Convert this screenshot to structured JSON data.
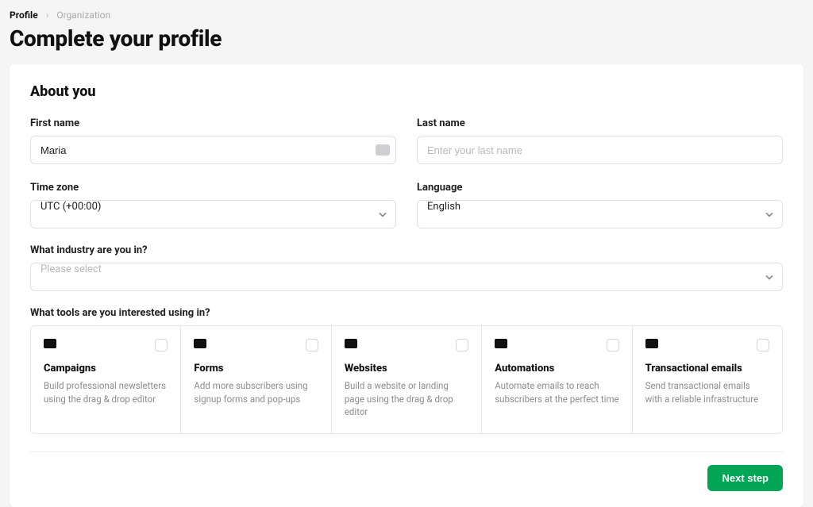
{
  "breadcrumb": {
    "active": "Profile",
    "next": "Organization"
  },
  "page_title": "Complete your profile",
  "section_title": "About you",
  "fields": {
    "first_name": {
      "label": "First name",
      "value": "Maria"
    },
    "last_name": {
      "label": "Last name",
      "value": "",
      "placeholder": "Enter your last name"
    },
    "timezone": {
      "label": "Time zone",
      "value": "UTC (+00:00)"
    },
    "language": {
      "label": "Language",
      "value": "English"
    },
    "industry": {
      "label": "What industry are you in?",
      "value": "",
      "placeholder": "Please select"
    }
  },
  "tools_label": "What tools are you interested using in?",
  "tools": [
    {
      "icon": "campaigns-icon",
      "title": "Campaigns",
      "desc": "Build professional newsletters using the drag & drop editor"
    },
    {
      "icon": "forms-icon",
      "title": "Forms",
      "desc": "Add more subscribers using signup forms and pop-ups"
    },
    {
      "icon": "websites-icon",
      "title": "Websites",
      "desc": "Build a website or landing page using the drag & drop editor"
    },
    {
      "icon": "automations-icon",
      "title": "Automations",
      "desc": "Automate emails to reach subscribers at the perfect time"
    },
    {
      "icon": "transactional-icon",
      "title": "Transactional emails",
      "desc": "Send transactional emails with a reliable infrastructure"
    }
  ],
  "footer": {
    "next_label": "Next step"
  },
  "colors": {
    "accent": "#00a656"
  }
}
